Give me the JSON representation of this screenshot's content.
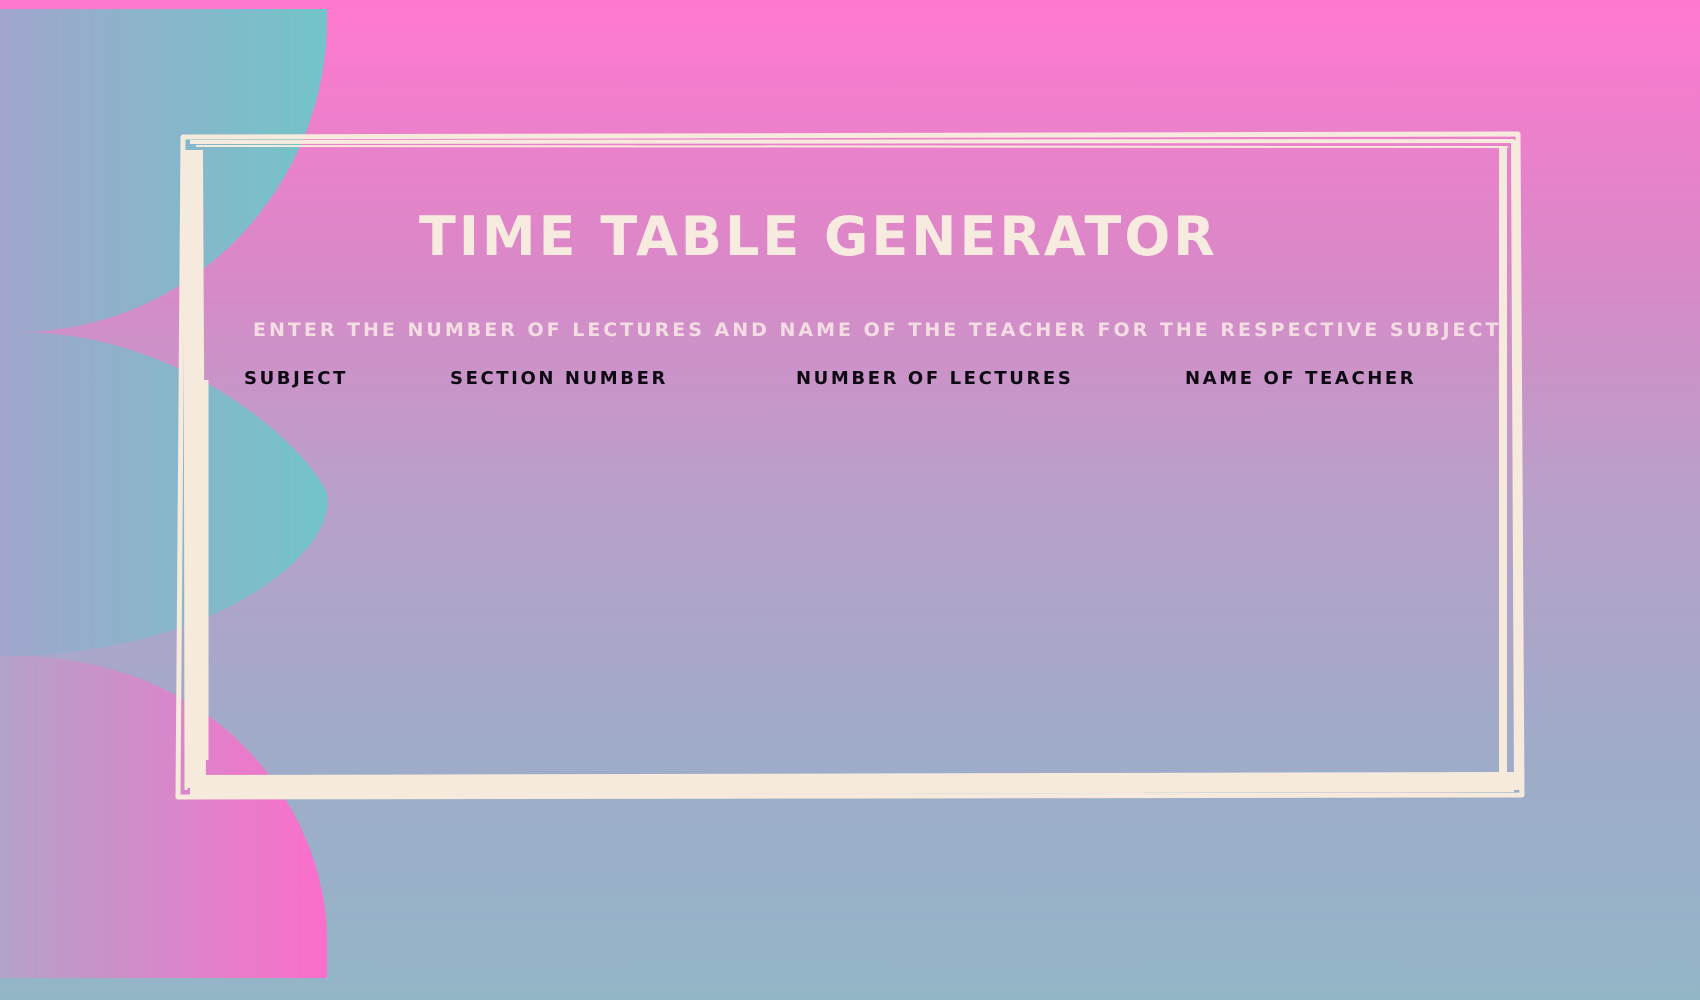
{
  "header": {
    "title": "TIME TABLE GENERATOR",
    "subtitle": "ENTER THE NUMBER OF LECTURES AND NAME OF THE TEACHER FOR THE RESPECTIVE SUBJECT"
  },
  "table": {
    "columns": [
      "SUBJECT",
      "SECTION NUMBER",
      "NUMBER OF LECTURES",
      "NAME OF TEACHER"
    ]
  },
  "colors": {
    "background_top": "#ff78cf",
    "background_bottom": "#93b6c7",
    "teal_shape": "#7bc0c8",
    "frame": "#f6eadc",
    "title_text": "#f7ebe0",
    "header_text": "#0e0a14"
  }
}
